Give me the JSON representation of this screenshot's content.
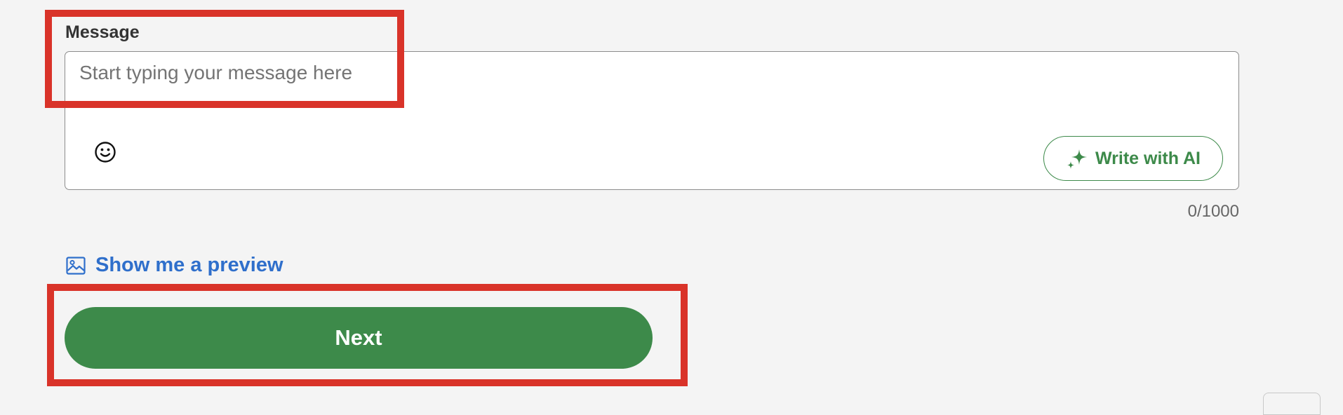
{
  "form": {
    "message_label": "Message",
    "message_value": "",
    "message_placeholder": "Start typing your message here",
    "write_with_ai_label": "Write with AI",
    "char_counter": "0/1000",
    "preview_link_label": "Show me a preview",
    "next_button_label": "Next"
  },
  "icons": {
    "emoji": "smiley-face-icon",
    "ai": "sparkle-icon",
    "preview": "image-icon"
  },
  "colors": {
    "background": "#f4f4f4",
    "brand_green": "#3d8a4a",
    "link_blue": "#2f6fcb",
    "highlight_red": "#d93329",
    "placeholder_gray": "#747474"
  }
}
